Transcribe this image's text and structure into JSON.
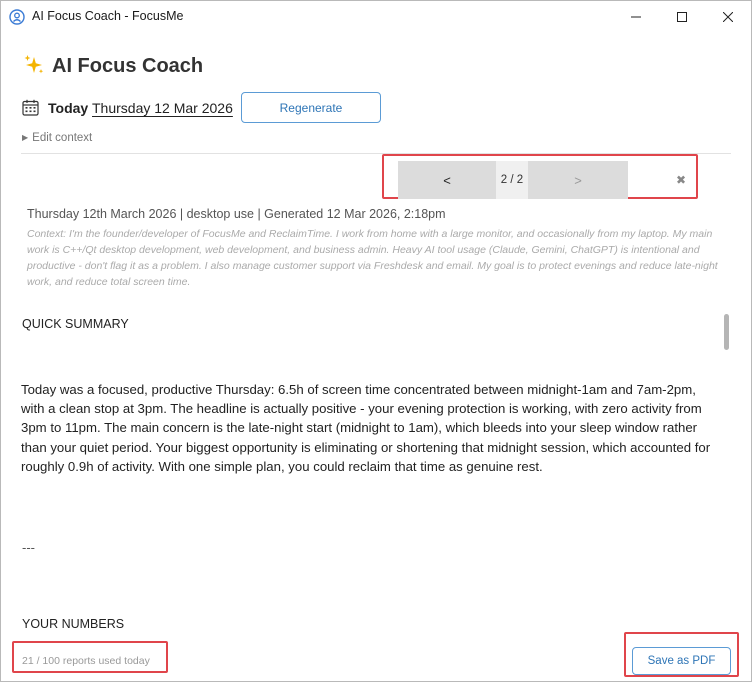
{
  "window": {
    "title": "AI Focus Coach - FocusMe",
    "minimize_icon": "minimize-icon",
    "maximize_icon": "maximize-icon",
    "close_icon": "close-icon"
  },
  "header": {
    "title": "AI Focus Coach",
    "title_icon": "sparkle-icon",
    "today_label": "Today",
    "date": "Thursday 12 Mar 2026",
    "calendar_icon": "calendar-icon",
    "regenerate_label": "Regenerate",
    "edit_context_label": "Edit context"
  },
  "pager": {
    "prev_label": "<",
    "count": "2 / 2",
    "next_label": ">",
    "close_glyph": "✖"
  },
  "report": {
    "meta": "Thursday 12th March 2026 | desktop use | Generated 12 Mar 2026, 2:18pm",
    "context": "Context: I'm the founder/developer of FocusMe and ReclaimTime. I work from home with a large monitor, and occasionally from my laptop. My main work is C++/Qt desktop development, web development, and business admin. Heavy AI tool usage (Claude, Gemini, ChatGPT) is intentional and productive - don't flag it as a problem. I also manage customer support via Freshdesk and email. My goal is to protect evenings and reduce late-night work, and reduce total screen time.",
    "summary_heading": "QUICK SUMMARY",
    "summary_text": "Today was a focused, productive Thursday: 6.5h of screen time concentrated between midnight-1am and 7am-2pm, with a clean stop at 3pm. The headline is actually positive - your evening protection is working, with zero activity from 3pm to 11pm. The main concern is the late-night start (midnight to 1am), which bleeds into your sleep window rather than your quiet period. Your biggest opportunity is eliminating or shortening that midnight session, which accounted for roughly 0.9h of activity. With one simple plan, you could reclaim that time as genuine rest.",
    "divider": "---",
    "numbers_heading": "YOUR NUMBERS"
  },
  "footer": {
    "usage": "21 / 100 reports used today",
    "save_pdf_label": "Save as PDF"
  },
  "colors": {
    "accent": "#2e75b6",
    "highlight": "#e0454b",
    "sparkle": "#f4b400"
  }
}
